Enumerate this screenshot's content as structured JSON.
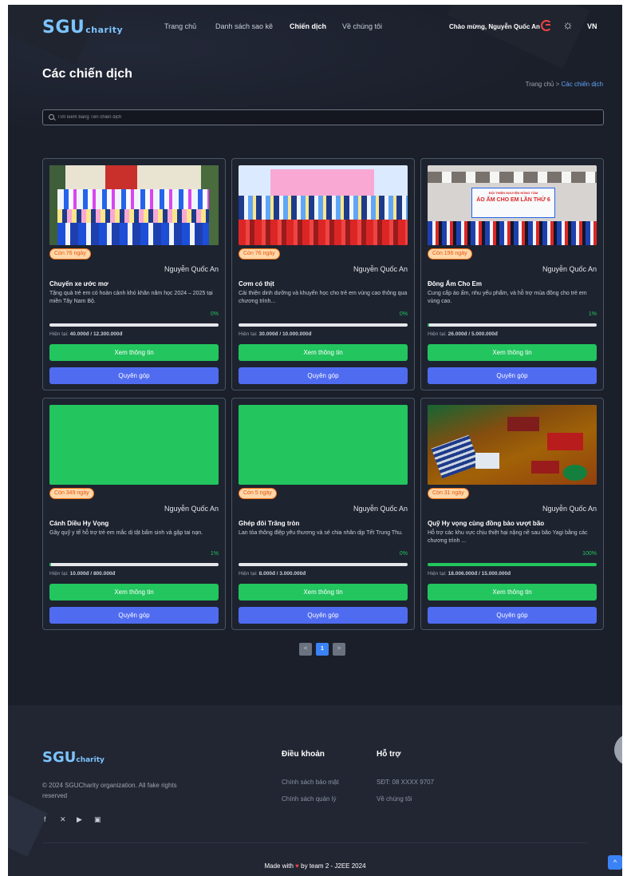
{
  "header": {
    "logo_main": "SGU",
    "logo_sub": "charity",
    "nav": [
      "Trang chủ",
      "Danh sách sao kê",
      "Chiến dịch",
      "Về chúng tôi"
    ],
    "welcome": "Chào mừng, Nguyễn Quốc An",
    "lang": "VN"
  },
  "page": {
    "title": "Các chiến dịch",
    "breadcrumb_home": "Trang chủ",
    "breadcrumb_sep": ">",
    "breadcrumb_current": "Các chiến dịch"
  },
  "search": {
    "placeholder": "Tìm kiếm bằng Tên chiến dịch"
  },
  "campaigns": [
    {
      "days": "Còn 76 ngày",
      "author": "Nguyễn Quốc An",
      "name": "Chuyến xe ước mơ",
      "desc": "Tặng quà trẻ em có hoàn cảnh khó khăn năm học 2024 – 2025 tại miền Tây Nam Bộ.",
      "percent": "0%",
      "progress": 0,
      "amount_label": "Hiện tại:",
      "amount": "40.000đ / 12.300.000đ",
      "view_label": "Xem thông tin",
      "donate_label": "Quyên góp"
    },
    {
      "days": "Còn 76 ngày",
      "author": "Nguyễn Quốc An",
      "name": "Cơm có thịt",
      "desc": "Cải thiện dinh dưỡng và khuyến học cho trẻ em vùng cao thông qua chương trình...",
      "percent": "0%",
      "progress": 0,
      "amount_label": "Hiện tại:",
      "amount": "30.000đ / 10.000.000đ",
      "view_label": "Xem thông tin",
      "donate_label": "Quyên góp"
    },
    {
      "days": "Còn 196 ngày",
      "author": "Nguyễn Quốc An",
      "name": "Đông Ấm Cho Em",
      "desc": "Cung cấp áo ấm, nhu yếu phẩm, và hỗ trợ mùa đông cho trẻ em vùng cao.",
      "percent": "1%",
      "progress": 0.01,
      "amount_label": "Hiện tại:",
      "amount": "26.000đ / 5.000.000đ",
      "view_label": "Xem thông tin",
      "donate_label": "Quyên góp",
      "banner_line1": "ĐỘI THIỆN NGUYỆN HỒNG TÂM",
      "banner_line2": "ÁO ẤM CHO EM LẦN THỨ 6"
    },
    {
      "days": "Còn 349 ngày",
      "author": "Nguyễn Quốc An",
      "name": "Cánh Diều Hy Vọng",
      "desc": "Gây quỹ y tế hỗ trợ trẻ em mắc dị tật bẩm sinh và gặp tai nạn.",
      "percent": "1%",
      "progress": 0.01,
      "amount_label": "Hiện tại:",
      "amount": "10.000đ / 800.000đ",
      "view_label": "Xem thông tin",
      "donate_label": "Quyên góp"
    },
    {
      "days": "Còn 5 ngày",
      "author": "Nguyễn Quốc An",
      "name": "Ghép đôi Trăng tròn",
      "desc": "Lan tỏa thông điệp yêu thương và sẻ chia nhân dịp Tết Trung Thu.",
      "percent": "0%",
      "progress": 0,
      "amount_label": "Hiện tại:",
      "amount": "8.000đ / 3.000.000đ",
      "view_label": "Xem thông tin",
      "donate_label": "Quyên góp"
    },
    {
      "days": "Còn 31 ngày",
      "author": "Nguyễn Quốc An",
      "name": "Quỹ Hy vọng cùng đồng bào vượt bão",
      "desc": "Hỗ trợ các khu vực chịu thiệt hại nặng nề sau bão Yagi bằng các chương trình ...",
      "percent": "100%",
      "progress": 1,
      "amount_label": "Hiện tại:",
      "amount": "18.006.000đ / 15.000.000đ",
      "view_label": "Xem thông tin",
      "donate_label": "Quyên góp"
    }
  ],
  "pagination": {
    "prev": "<",
    "current": "1",
    "next": ">"
  },
  "footer": {
    "logo_main": "SGU",
    "logo_sub": "charity",
    "copyright": "© 2024 SGUCharity organization. All fake rights reserved",
    "col1_title": "Điều khoản",
    "col1_links": [
      "Chính sách bảo mật",
      "Chính sách quản lý"
    ],
    "col2_title": "Hỗ trợ",
    "col2_links": [
      "SĐT: 08 XXXX 9707",
      "Về chúng tôi"
    ],
    "made_prefix": "Made with",
    "made_suffix": "by team 2 - J2EE 2024",
    "social_icons": [
      "facebook-icon",
      "x-icon",
      "youtube-icon",
      "linkedin-icon"
    ]
  },
  "colors": {
    "background": "#1b1f2a",
    "accent_green": "#22c55e",
    "accent_blue": "#4f6bf0",
    "badge_orange": "#fed7aa",
    "logo": "#7cc4ff"
  }
}
